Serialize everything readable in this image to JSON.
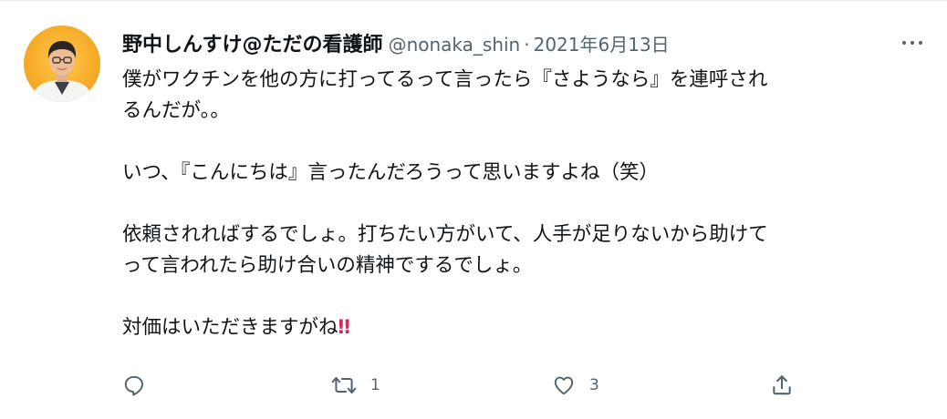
{
  "tweet": {
    "author": {
      "display_name": "野中しんすけ@ただの看護師",
      "handle": "@nonaka_shin",
      "separator": "·",
      "date": "2021年6月13日"
    },
    "text": {
      "line1": "僕がワクチンを他の方に打ってるって言ったら『さようなら』を連呼され",
      "line2": "るんだが。。",
      "line3": "いつ、『こんにちは』言ったんだろうって思いますよね（笑）",
      "line4": "依頼されればするでしょ。打ちたい方がいて、人手が足りないから助けて",
      "line5": "って言われたら助け合いの精神でするでしょ。",
      "line6": "対価はいただきますがね",
      "emphasis": "‼"
    },
    "actions": {
      "reply_icon": "reply-icon",
      "retweet_icon": "retweet-icon",
      "retweet_count": "1",
      "like_icon": "like-icon",
      "like_count": "3",
      "share_icon": "share-icon"
    },
    "more_icon": "more-options-icon",
    "colors": {
      "text": "#0f1419",
      "secondary": "#536471",
      "emphasis": "#e0245e",
      "avatar_bg": "#f5a623"
    }
  }
}
